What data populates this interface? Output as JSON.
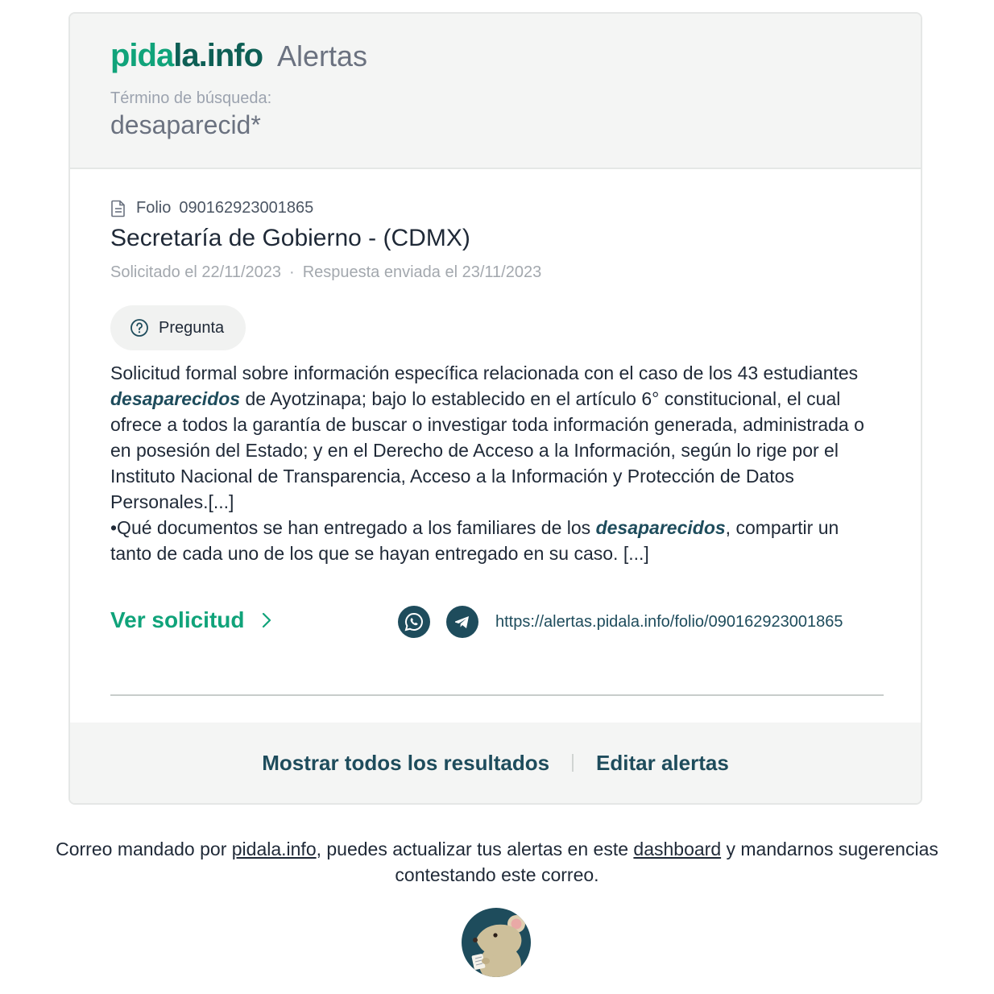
{
  "header": {
    "brand_prefix": "pida",
    "brand_suffix": "la.info",
    "section_title": "Alertas",
    "search_label": "Término de búsqueda:",
    "search_term": "desaparecid*"
  },
  "result": {
    "folio_label": "Folio",
    "folio_number": "090162923001865",
    "agency": "Secretaría de Gobierno - (CDMX)",
    "requested": "Solicitado el 22/11/2023",
    "date_separator": "·",
    "answered": "Respuesta enviada el 23/11/2023",
    "tag_label": "Pregunta",
    "body": {
      "p1_a": "Solicitud formal sobre información específica relacionada con el caso de los 43 estudiantes ",
      "p1_hl": "desaparecidos",
      "p1_b": " de Ayotzinapa; bajo lo establecido en el artículo 6° constitucional, el cual ofrece a todos la garantía de buscar o investigar toda información generada, administrada o en posesión del Estado; y en el Derecho de Acceso a la Información, según lo rige por el Instituto Nacional de Transparencia, Acceso a la Información y Protección de Datos Personales.[...]",
      "p2_a": "•Qué documentos se han entregado a los familiares de los ",
      "p2_hl": "desaparecidos",
      "p2_b": ", compartir un tanto de cada uno de los que se hayan entregado en su caso. [...]"
    },
    "view_label": "Ver solicitud",
    "share_url": "https://alertas.pidala.info/folio/090162923001865"
  },
  "footer": {
    "show_all": "Mostrar todos los resultados",
    "edit_alerts": "Editar alertas"
  },
  "note": {
    "t1": "Correo mandado por ",
    "link1": "pidala.info",
    "t2": ", puedes actualizar tus alertas en este ",
    "link2": "dashboard",
    "t3": " y mandarnos sugerencias contestando este correo."
  },
  "colors": {
    "brand_green": "#10a37a",
    "brand_dark": "#1e4c5c",
    "header_bg": "#f4f5f4"
  }
}
